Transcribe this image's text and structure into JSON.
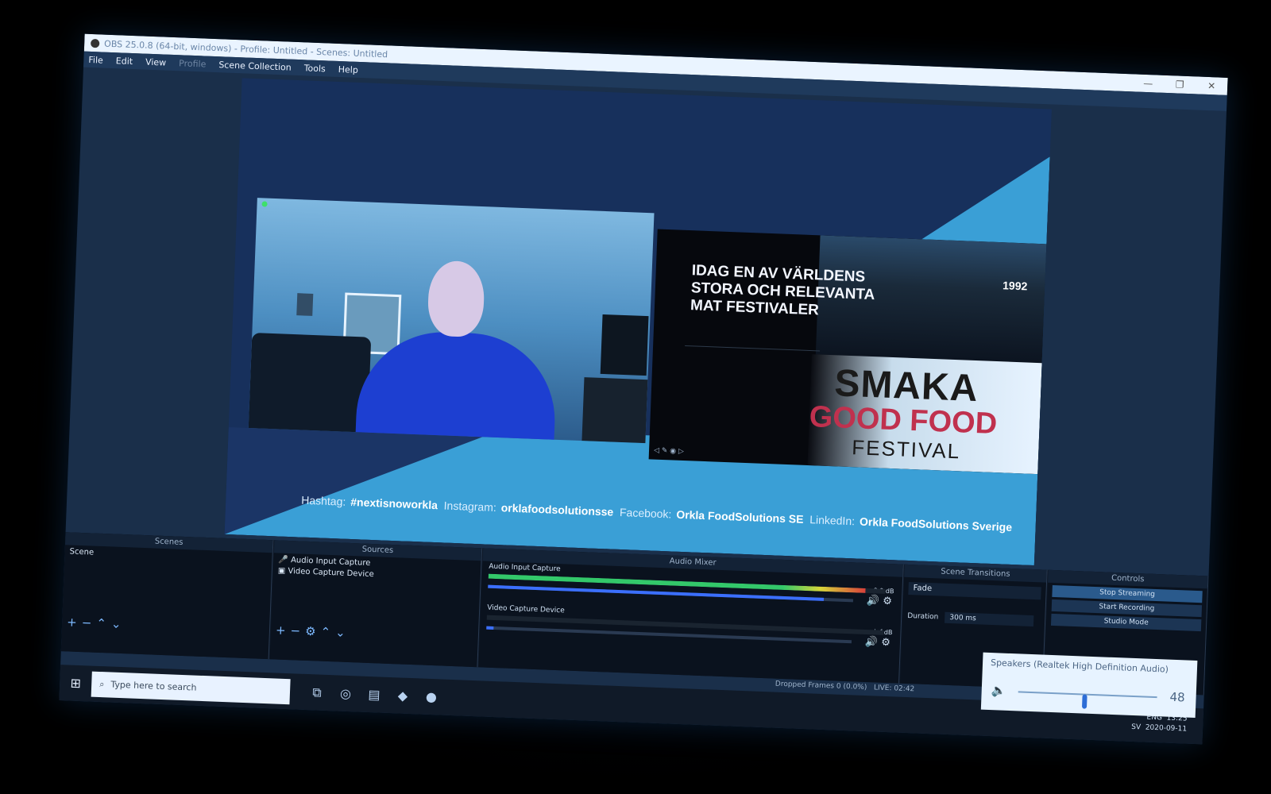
{
  "window": {
    "title": "OBS 25.0.8 (64-bit, windows) - Profile: Untitled - Scenes: Untitled",
    "controls": [
      "—",
      "❐",
      "✕"
    ]
  },
  "menu": {
    "items": [
      "File",
      "Edit",
      "View",
      "Profile",
      "Scene Collection",
      "Tools",
      "Help"
    ],
    "disabled_index": 3
  },
  "preview": {
    "slide": {
      "headline": "IDAG EN AV VÄRLDENS\nSTORA OCH RELEVANTA\nMAT FESTIVALER",
      "year": "1992",
      "logo_line1": "SMAKA",
      "logo_line2": "GOOD FOOD",
      "logo_line3": "FESTIVAL"
    },
    "hashline": {
      "hashtag_label": "Hashtag:",
      "hashtag_value": "#nextisnoworkla",
      "instagram_label": "Instagram:",
      "instagram_value": "orklafoodsolutionsse",
      "facebook_label": "Facebook:",
      "facebook_value": "Orkla FoodSolutions SE",
      "linkedin_label": "LinkedIn:",
      "linkedin_value": "Orkla FoodSolutions Sverige"
    }
  },
  "scenes": {
    "title": "Scenes",
    "items": [
      "Scene"
    ]
  },
  "sources": {
    "title": "Sources",
    "items": [
      "Audio Input Capture",
      "Video Capture Device"
    ]
  },
  "mixer": {
    "title": "Audio Mixer",
    "channels": [
      {
        "name": "Audio Input Capture",
        "db": "0.0 dB",
        "level": 0.95,
        "fader": 0.92
      },
      {
        "name": "Video Capture Device",
        "db": "-inf dB",
        "level": 0.0,
        "fader": 0.02
      }
    ]
  },
  "transitions": {
    "title": "Scene Transitions",
    "selected": "Fade",
    "duration_label": "Duration",
    "duration_value": "300 ms"
  },
  "controls": {
    "title": "Controls",
    "buttons": [
      "Stop Streaming",
      "Start Recording",
      "Studio Mode"
    ]
  },
  "status": {
    "dropped": "Dropped Frames 0 (0.0%)",
    "live": "LIVE: 02:42"
  },
  "taskbar": {
    "search_placeholder": "Type here to search",
    "tray_lang": "ENG",
    "tray_sub": "SV",
    "time": "13:25",
    "date": "2020-09-11"
  },
  "volume_popup": {
    "title": "Speakers (Realtek High Definition Audio)",
    "value": "48",
    "level": 0.48
  }
}
